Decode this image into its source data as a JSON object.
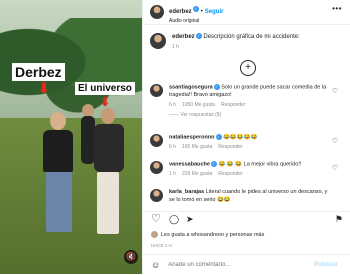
{
  "video": {
    "label_left": "Derbez",
    "label_right": "El universo",
    "arrow_glyph": "⬇",
    "mute_glyph": "🔇"
  },
  "header": {
    "username": "ederbez",
    "verified_glyph": "✓",
    "separator": "•",
    "follow_label": "Seguir",
    "audio": "Audio original",
    "more_glyph": "•••"
  },
  "caption": {
    "username": "ederbez",
    "text": "Descripción gráfica de mi accidente:",
    "age": "1 h"
  },
  "load_more_glyph": "+",
  "comments": [
    {
      "username": "ssantiagosegura",
      "text": "Solo un grande puede sacar comedia de la tragedia!! Bravo amigazo!",
      "age": "6 h",
      "likes": "1050 Me gusta",
      "reply": "Responder",
      "replies": "—— Ver respuestas (8)"
    },
    {
      "username": "nataliaesperonnn",
      "text": "😂😂😂😂😂",
      "age": "6 h",
      "likes": "165 Me gusta",
      "reply": "Responder",
      "replies": ""
    },
    {
      "username": "vanessabauche",
      "text": "😂 😂 😂 La mejor vibra querido!!",
      "age": "1 h",
      "likes": "229 Me gusta",
      "reply": "Responder",
      "replies": ""
    },
    {
      "username": "karla_barajas",
      "text": "Literal cuando le pides al universo un descanso, y se lo tomó en serio 😂😂",
      "age": "",
      "likes": "",
      "reply": "",
      "replies": ""
    }
  ],
  "actions": {
    "like_glyph": "♡",
    "comment_glyph": "◯",
    "share_glyph": "➤",
    "save_glyph": "⚑"
  },
  "likes_text": "Les gusta a whosandreoo y personas más",
  "date": "HACE 1 H",
  "add_comment": {
    "emoji_glyph": "☺",
    "placeholder": "Añade un comentario...",
    "publish": "Publicar"
  }
}
